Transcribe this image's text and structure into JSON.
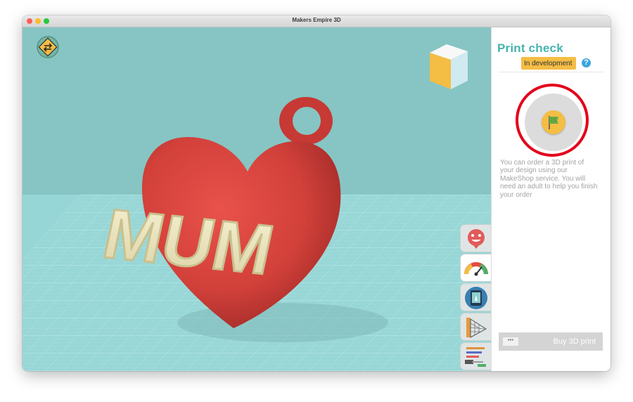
{
  "window": {
    "title": "Makers Empire 3D"
  },
  "scene": {
    "model_text": "MUM"
  },
  "panel": {
    "title": "Print check",
    "badge": "In development",
    "help_icon": "?",
    "description": "You can order a 3D print of your design using our MakeShop service. You will need an adult to help you finish your order",
    "buy_icon": "***",
    "buy_button": "Buy 3D print"
  },
  "toolbar": {
    "tools": [
      "face-icon",
      "gauge-icon",
      "tablet-icon",
      "grid-ruler-icon",
      "tools-icon"
    ],
    "active_tool": "gauge-icon"
  },
  "colors": {
    "accent": "#46b3ad",
    "badge": "#f4bd44",
    "heart": "#d8423c",
    "letters": "#efe9c3",
    "highlight": "#e3001a",
    "viewport_bg": "#86c5c3"
  }
}
